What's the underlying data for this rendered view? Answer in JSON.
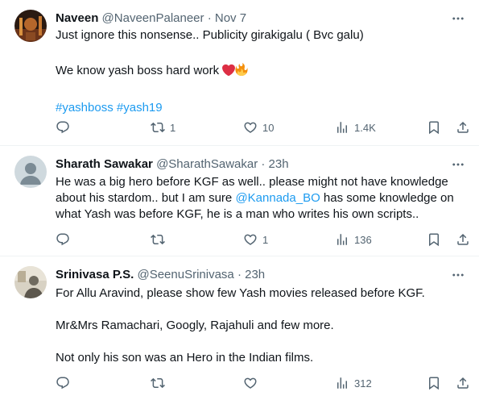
{
  "tweets": [
    {
      "name": "Naveen",
      "handle": "@NaveenPalaneer",
      "separator": "·",
      "time": "Nov 7",
      "text_line1": "Just ignore this nonsense.. Publicity girakigalu ( Bvc galu)",
      "text_line2": "We know yash boss hard work",
      "hashtags": "#yashboss #yash19",
      "retweets": "1",
      "likes": "10",
      "views": "1.4K",
      "avatar_colors": [
        "#3b2418",
        "#8a4a22",
        "#c77a33"
      ]
    },
    {
      "name": "Sharath Sawakar",
      "handle": "@SharathSawakar",
      "separator": "·",
      "time": "23h",
      "text_part1": "He was a big hero before KGF as well.. please might not have knowledge about his stardom.. but I am sure ",
      "mention": "@Kannada_BO",
      "text_part2": " has some knowledge on what Yash was before KGF, he is a man who writes his own scripts..",
      "retweets": "",
      "likes": "1",
      "views": "136",
      "avatar_colors": [
        "#cfd9de",
        "#7b8b95"
      ]
    },
    {
      "name": "Srinivasa P.S.",
      "handle": "@SeenuSrinivasa",
      "separator": "·",
      "time": "23h",
      "text_line1": "For Allu Aravind, please show few Yash movies released before KGF.",
      "text_line2": "Mr&Mrs Ramachari, Googly, Rajahuli and few more.",
      "text_line3": "Not only his son was an Hero in the Indian films.",
      "retweets": "",
      "likes": "",
      "views": "312",
      "avatar_colors": [
        "#cfc8b9",
        "#6f6a5f"
      ]
    }
  ],
  "icons": {
    "reply": "reply-icon",
    "retweet": "retweet-icon",
    "like": "heart-icon",
    "views": "views-chart-icon",
    "bookmark": "bookmark-icon",
    "share": "share-icon",
    "more": "more-icon"
  },
  "colors": {
    "text": "#0f1419",
    "secondary": "#536471",
    "link": "#1d9bf0",
    "divider": "#eff3f4"
  }
}
